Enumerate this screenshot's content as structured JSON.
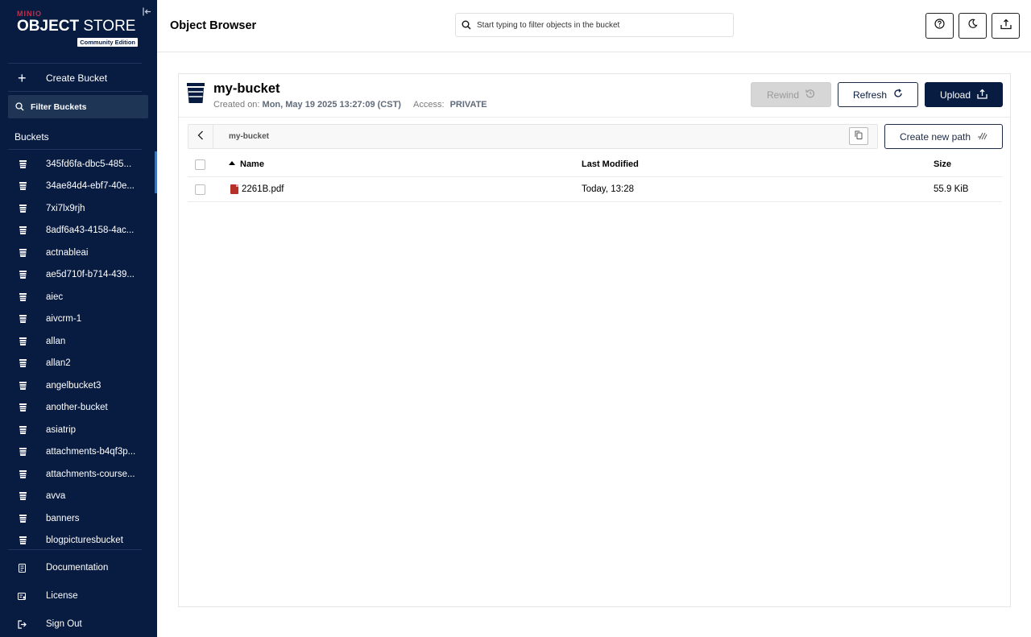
{
  "sidebar": {
    "logo": {
      "brand": "MINIO",
      "product_bold": "OBJECT",
      "product_rest": " STORE",
      "edition": "Community Edition"
    },
    "create_bucket_label": "Create Bucket",
    "filter_buckets_label": "Filter Buckets",
    "buckets_title": "Buckets",
    "buckets": [
      {
        "name": "345fd6fa-dbc5-485..."
      },
      {
        "name": "34ae84d4-ebf7-40e..."
      },
      {
        "name": "7xi7lx9rjh"
      },
      {
        "name": "8adf6a43-4158-4ac..."
      },
      {
        "name": "actnableai"
      },
      {
        "name": "ae5d710f-b714-439..."
      },
      {
        "name": "aiec"
      },
      {
        "name": "aivcrm-1"
      },
      {
        "name": "allan"
      },
      {
        "name": "allan2"
      },
      {
        "name": "angelbucket3"
      },
      {
        "name": "another-bucket"
      },
      {
        "name": "asiatrip"
      },
      {
        "name": "attachments-b4qf3p..."
      },
      {
        "name": "attachments-course..."
      },
      {
        "name": "avva"
      },
      {
        "name": "banners"
      },
      {
        "name": "blogpicturesbucket"
      }
    ],
    "footer": {
      "documentation": "Documentation",
      "license": "License",
      "sign_out": "Sign Out"
    }
  },
  "header": {
    "title": "Object Browser",
    "search_placeholder": "Start typing to filter objects in the bucket"
  },
  "bucket": {
    "name": "my-bucket",
    "created_label": "Created on:",
    "created_value": "Mon, May 19 2025 13:27:09 (CST)",
    "access_label": "Access:",
    "access_value": "PRIVATE",
    "buttons": {
      "rewind": "Rewind",
      "refresh": "Refresh",
      "upload": "Upload"
    }
  },
  "breadcrumb": {
    "path": "my-bucket",
    "create_path_label": "Create new path"
  },
  "table": {
    "columns": {
      "name": "Name",
      "last_modified": "Last Modified",
      "size": "Size"
    },
    "rows": [
      {
        "name": "2261B.pdf",
        "last_modified": "Today, 13:28",
        "size": "55.9 KiB"
      }
    ]
  },
  "colors": {
    "sidebar_bg": "#081c42",
    "accent_red": "#c72c48",
    "primary_button": "#081c42"
  }
}
